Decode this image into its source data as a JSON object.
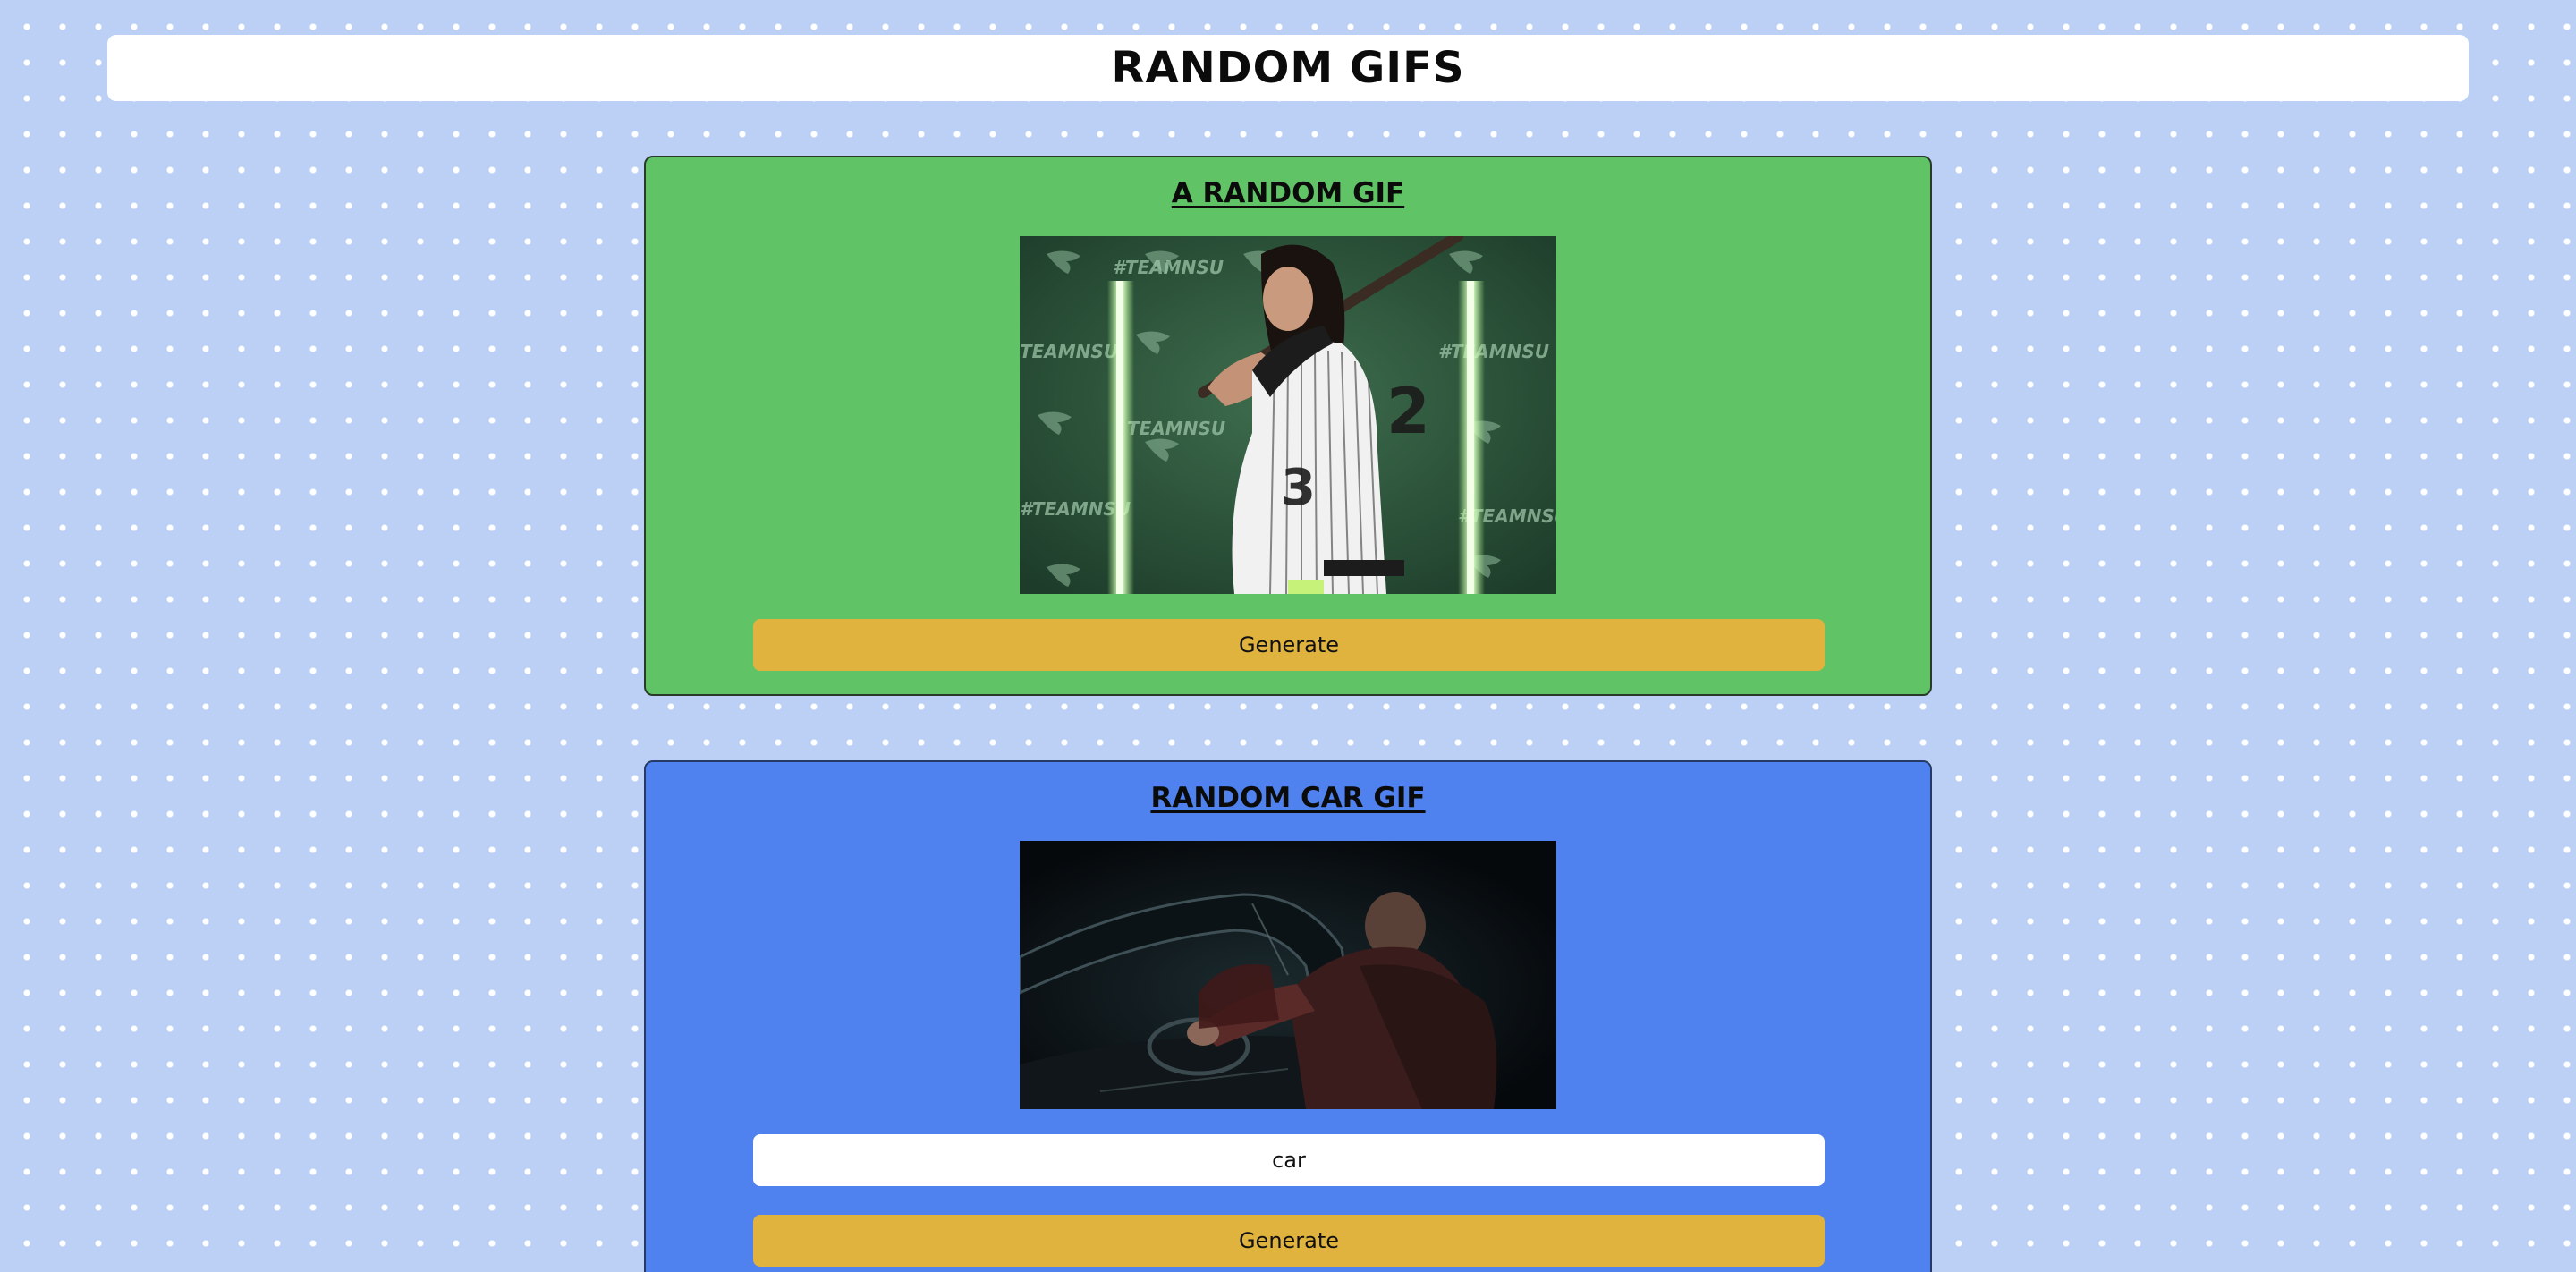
{
  "header": {
    "title": "RANDOM GIFS"
  },
  "random_gif_card": {
    "title": "A RANDOM GIF",
    "generate_label": "Generate",
    "background_color": "#60c466",
    "image_text": {
      "watermark_1": "#TEAMNSU",
      "watermark_2": "TEAMNSU",
      "watermark_3": "#TEAMNSU",
      "watermark_4": "#TEAMNSU",
      "watermark_5": "TEAMNSU",
      "watermark_6": "#TEAMNSU"
    }
  },
  "car_gif_card": {
    "title": "RANDOM CAR GIF",
    "search_value": "car",
    "generate_label": "Generate",
    "background_color": "#4f82ee"
  },
  "colors": {
    "page_background": "#bcd0f6",
    "button": "#e0b23e"
  }
}
